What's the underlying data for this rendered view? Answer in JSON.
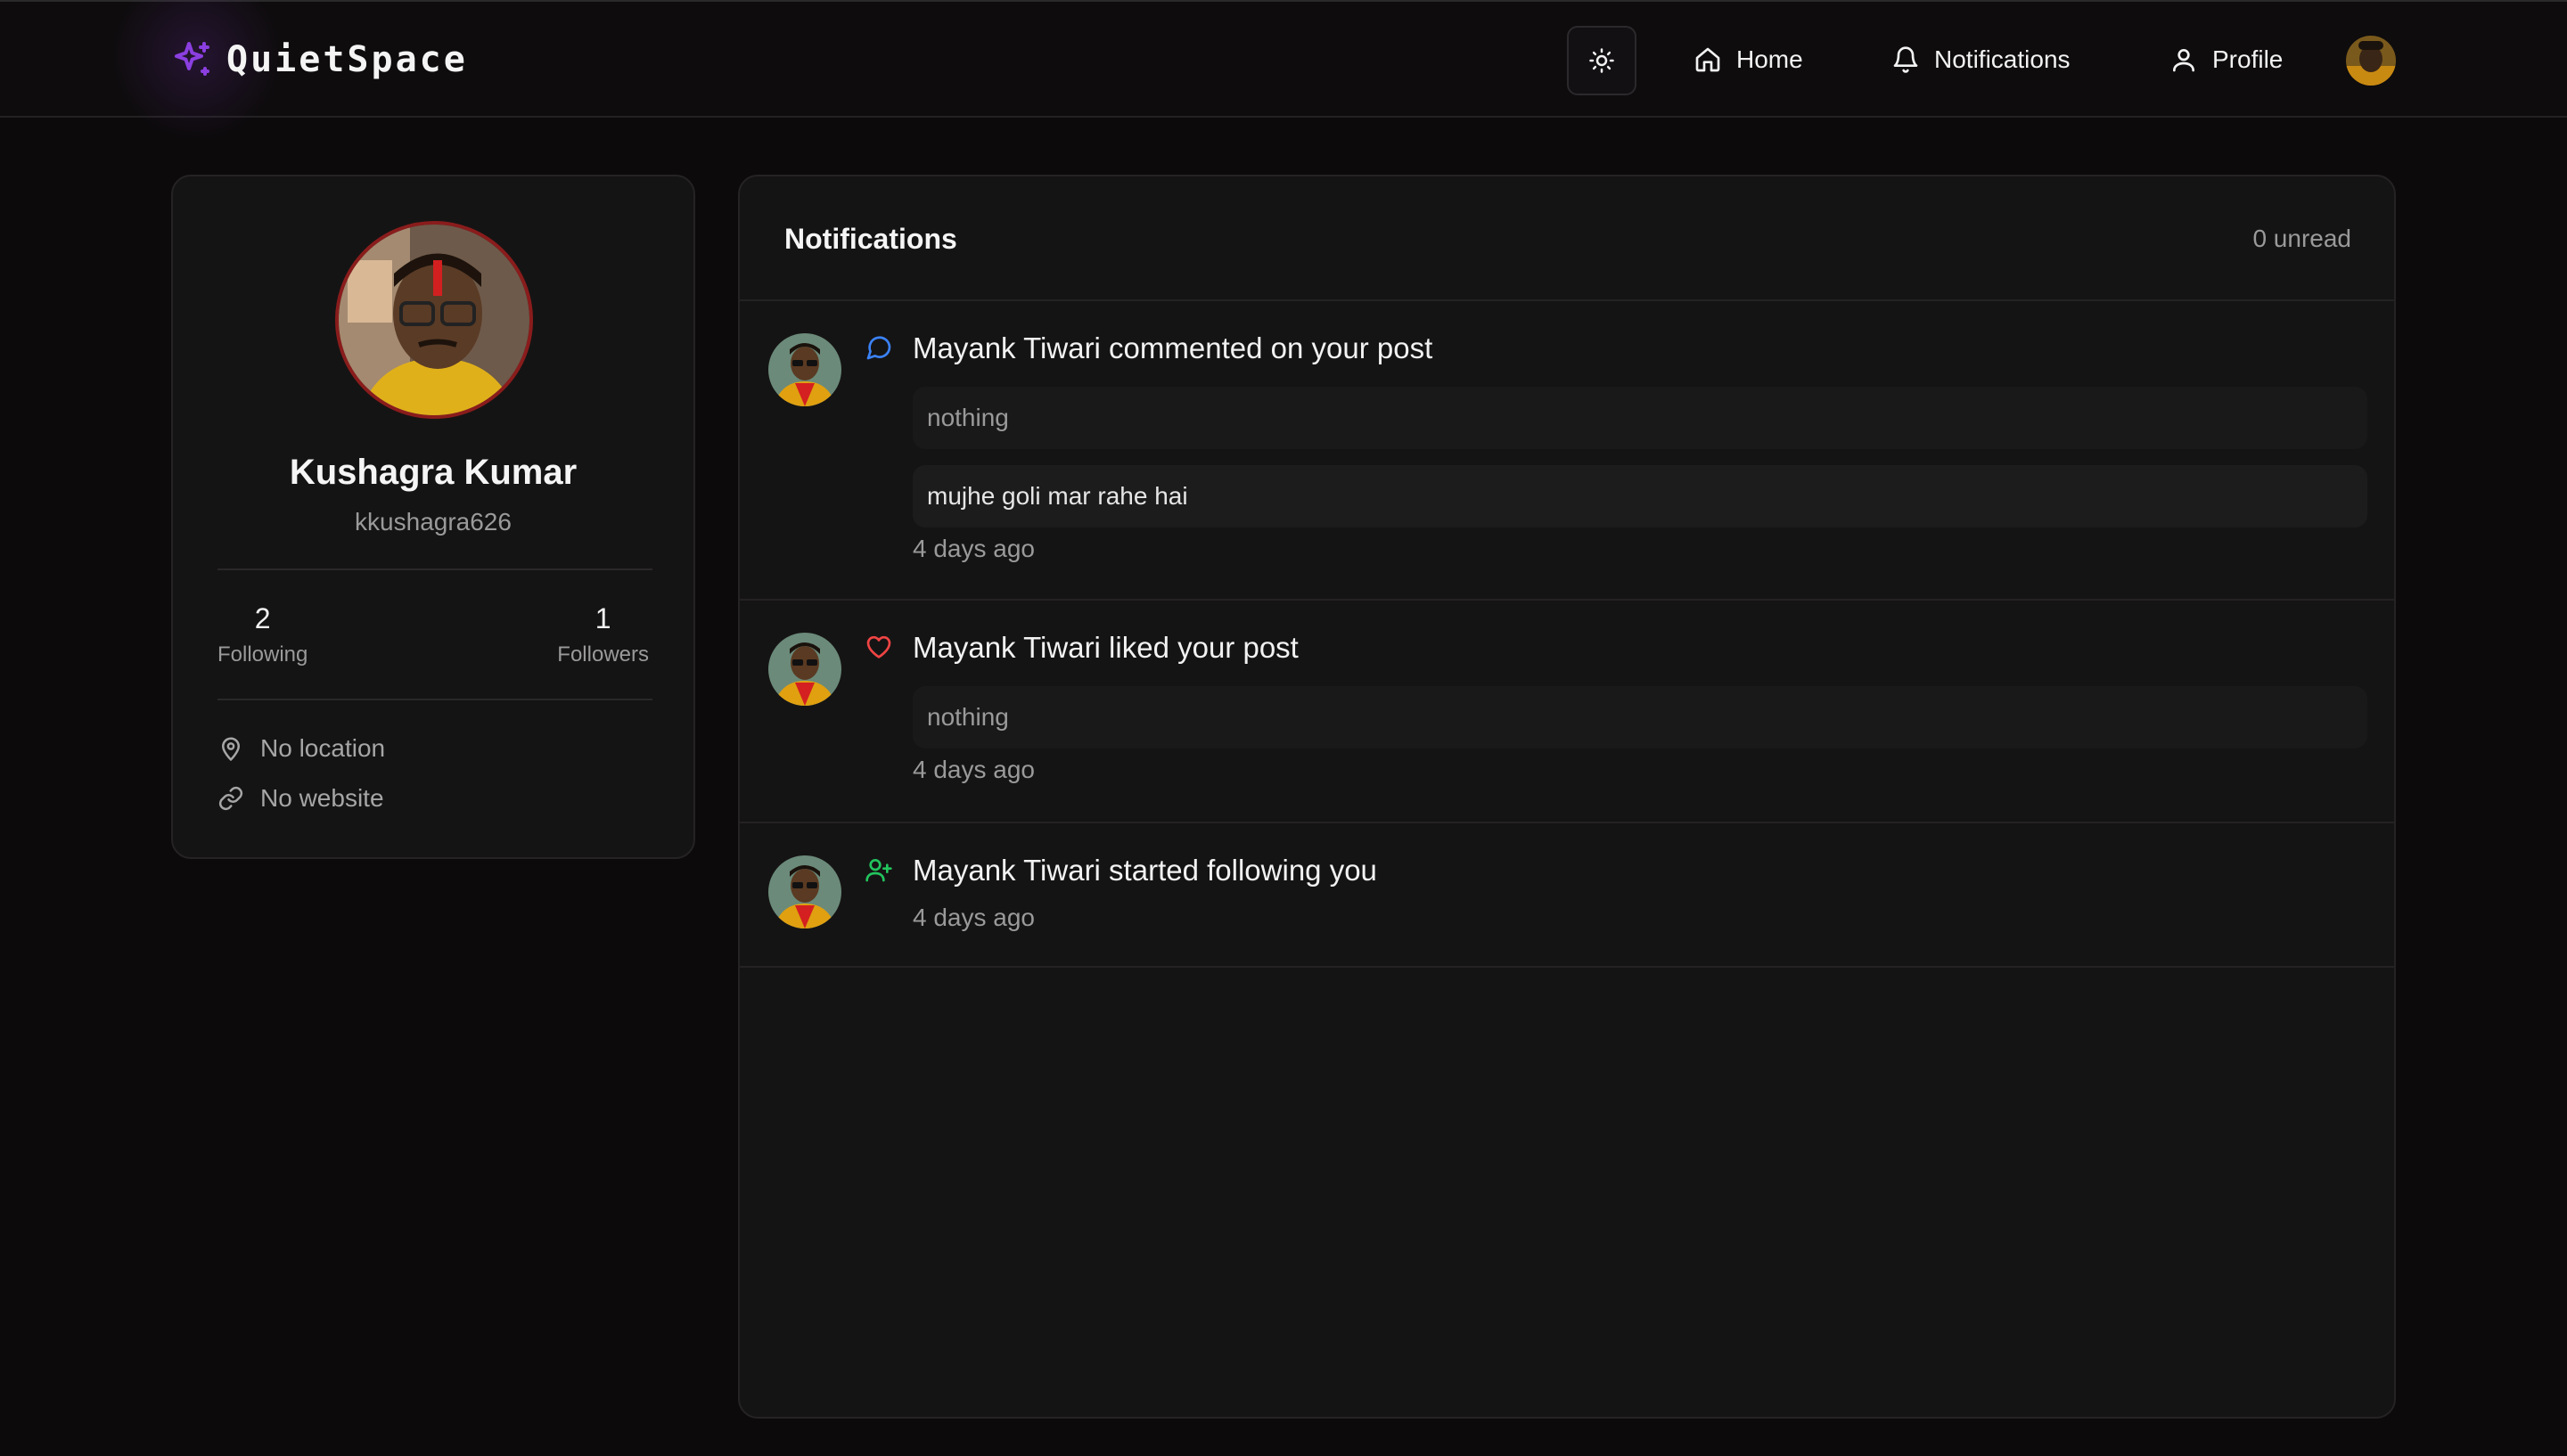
{
  "brand": {
    "name": "QuietSpace",
    "accent": "#8b3fe0"
  },
  "nav": {
    "theme_icon": "sun-icon",
    "items": [
      {
        "label": "Home",
        "icon": "home-icon"
      },
      {
        "label": "Notifications",
        "icon": "bell-icon"
      },
      {
        "label": "Profile",
        "icon": "user-icon"
      }
    ]
  },
  "profile": {
    "name": "Kushagra Kumar",
    "handle": "kkushagra626",
    "following_count": "2",
    "following_label": "Following",
    "followers_count": "1",
    "followers_label": "Followers",
    "location": "No location",
    "website": "No website"
  },
  "notifications": {
    "title": "Notifications",
    "unread": "0 unread",
    "items": [
      {
        "type": "comment",
        "icon": "message-circle-icon",
        "icon_color": "#3b82f6",
        "user": "Mayank Tiwari",
        "action": " commented on your post",
        "post_excerpt": "nothing",
        "comment": "mujhe goli mar rahe hai",
        "time": "4 days ago"
      },
      {
        "type": "like",
        "icon": "heart-icon",
        "icon_color": "#ef4444",
        "user": "Mayank Tiwari",
        "action": " liked your post",
        "post_excerpt": "nothing",
        "time": "4 days ago"
      },
      {
        "type": "follow",
        "icon": "user-plus-icon",
        "icon_color": "#22c55e",
        "user": "Mayank Tiwari",
        "action": " started following you",
        "time": "4 days ago"
      }
    ]
  }
}
